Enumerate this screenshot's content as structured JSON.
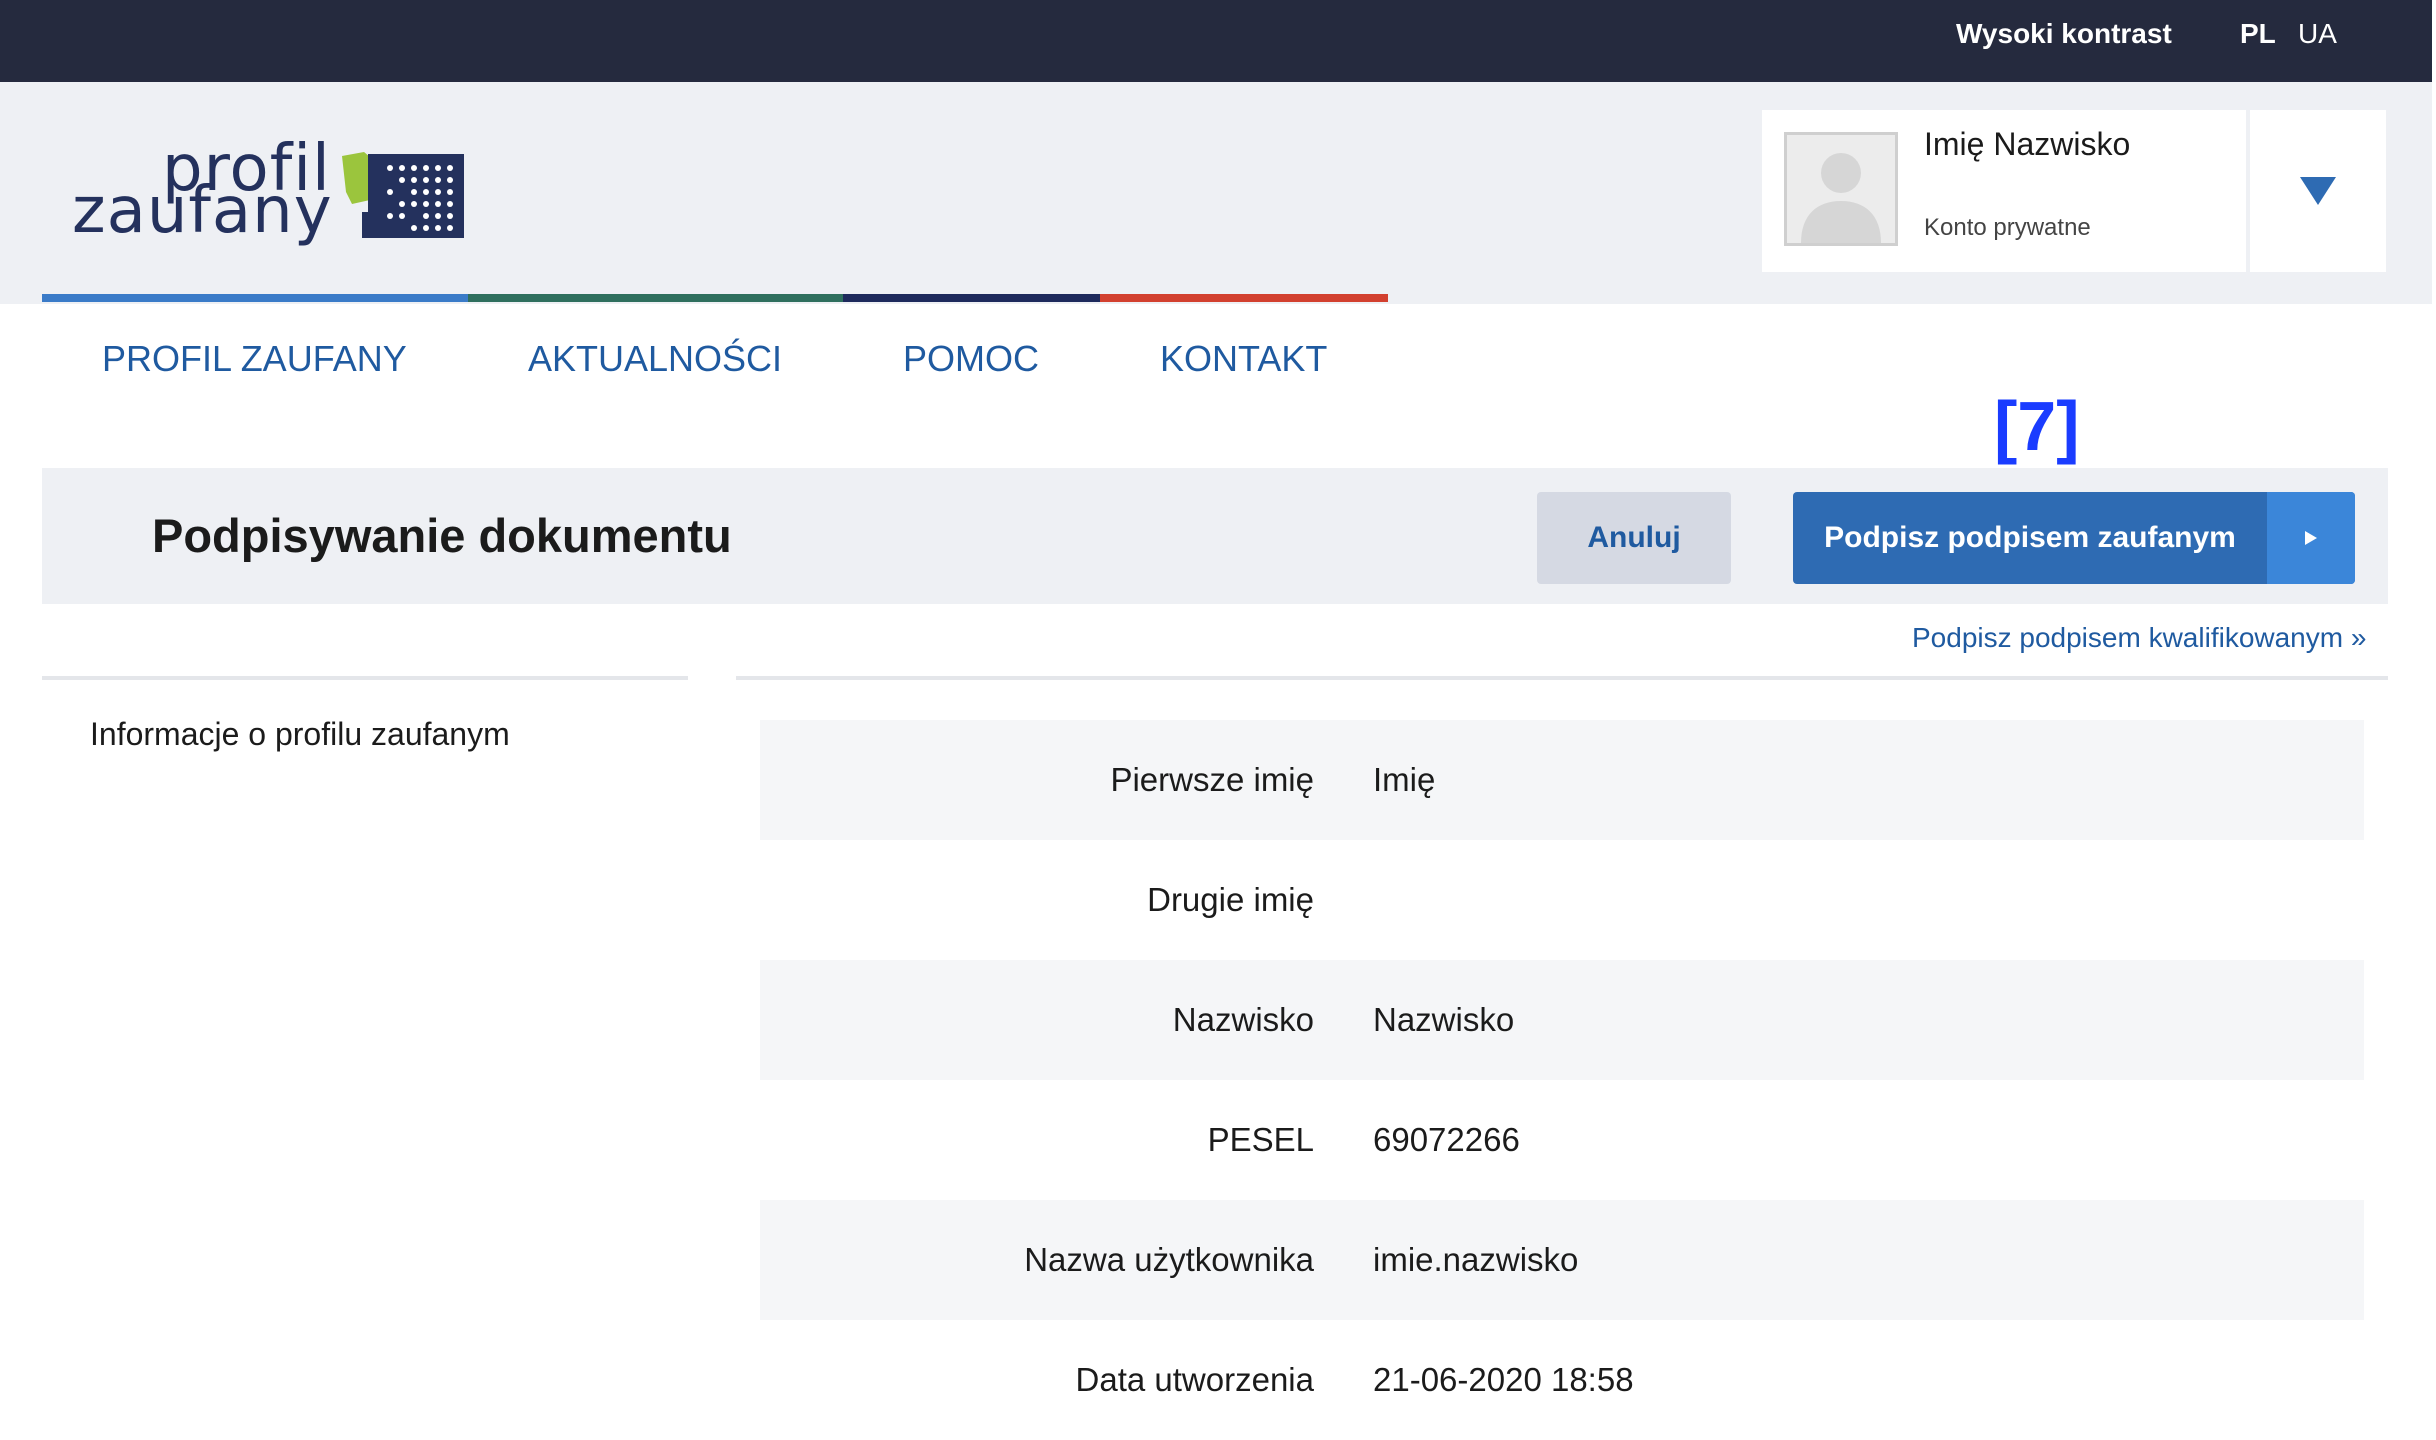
{
  "topbar": {
    "contrast_label": "Wysoki kontrast",
    "lang_pl": "PL",
    "lang_ua": "UA"
  },
  "logo": {
    "line1": "profil",
    "line2": "zaufany"
  },
  "user": {
    "name": "Imię Nazwisko",
    "account_type": "Konto prywatne",
    "dropdown_icon": "triangle-down-icon"
  },
  "nav": {
    "items": [
      {
        "label": "PROFIL ZAUFANY"
      },
      {
        "label": "AKTUALNOŚCI"
      },
      {
        "label": "POMOC"
      },
      {
        "label": "KONTAKT"
      }
    ]
  },
  "annotation": "[7]",
  "page": {
    "title": "Podpisywanie dokumentu",
    "cancel_label": "Anuluj",
    "sign_label": "Podpisz podpisem zaufanym",
    "qualified_link": "Podpisz podpisem kwalifikowanym »"
  },
  "info": {
    "heading": "Informacje o profilu zaufanym",
    "rows": [
      {
        "label": "Pierwsze imię",
        "value": "Imię"
      },
      {
        "label": "Drugie imię",
        "value": ""
      },
      {
        "label": "Nazwisko",
        "value": "Nazwisko"
      },
      {
        "label": "PESEL",
        "value": "69072266"
      },
      {
        "label": "Nazwa użytkownika",
        "value": "imie.nazwisko"
      },
      {
        "label": "Data utworzenia",
        "value": "21-06-2020 18:58"
      }
    ]
  },
  "colors": {
    "topbar": "#252a3e",
    "header": "#eef0f4",
    "primary": "#2e6bb3",
    "link": "#1f5aa0",
    "stripe": [
      "#3a7bc8",
      "#2f6f5e",
      "#1e2a5c",
      "#d2402f"
    ]
  }
}
